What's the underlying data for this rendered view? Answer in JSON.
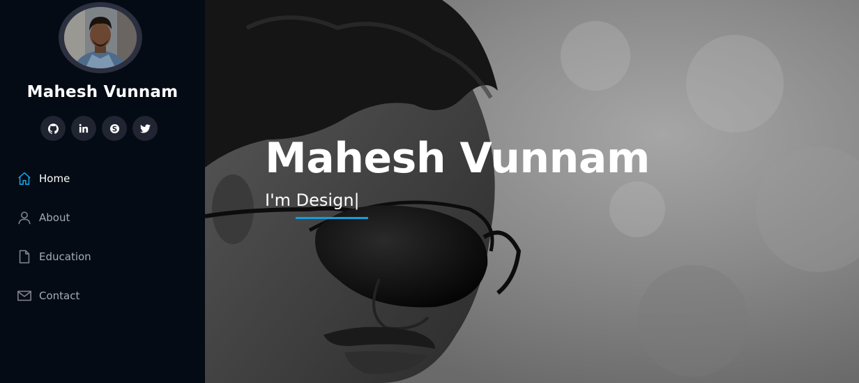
{
  "profile": {
    "name": "Mahesh Vunnam",
    "avatar_icon": "profile-photo"
  },
  "socials": [
    {
      "icon": "github-icon"
    },
    {
      "icon": "linkedin-icon"
    },
    {
      "icon": "skype-icon"
    },
    {
      "icon": "twitter-icon"
    }
  ],
  "nav": {
    "items": [
      {
        "label": "Home",
        "icon": "home-icon",
        "active": true
      },
      {
        "label": "About",
        "icon": "user-icon",
        "active": false
      },
      {
        "label": "Education",
        "icon": "file-icon",
        "active": false
      },
      {
        "label": "Contact",
        "icon": "envelope-icon",
        "active": false
      }
    ]
  },
  "hero": {
    "title": "Mahesh Vunnam",
    "typed_text": "I'm Design",
    "caret": "|"
  },
  "colors": {
    "sidebar_bg": "#040b14",
    "accent": "#149ddd",
    "social_bg": "#212431",
    "nav_text": "#a8a9b4"
  }
}
